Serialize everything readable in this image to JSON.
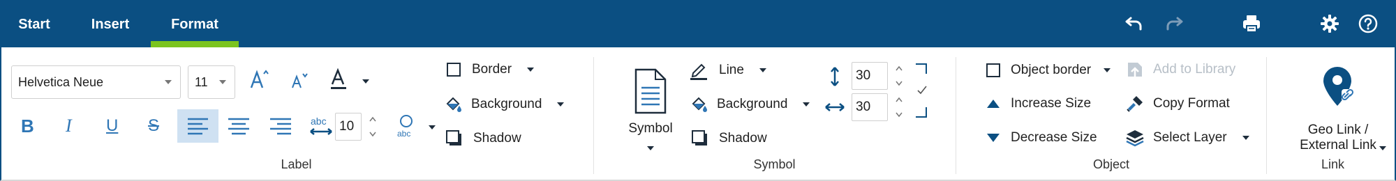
{
  "tabs": [
    {
      "label": "Start"
    },
    {
      "label": "Insert"
    },
    {
      "label": "Format"
    }
  ],
  "active_tab": "Format",
  "colors": {
    "topbar": "#0b4f82",
    "active_underline": "#7bc41f",
    "accent_icon": "#2f76b5",
    "icon_dark": "#0b4f82"
  },
  "toolbar_icons": [
    "undo-icon",
    "redo-icon",
    "print-icon",
    "gear-icon",
    "help-icon"
  ],
  "label_group": {
    "title": "Label",
    "font_family": "Helvetica Neue",
    "font_size": "11",
    "spacing_value": "10",
    "border_label": "Border",
    "background_label": "Background",
    "shadow_label": "Shadow",
    "align_left_active": true
  },
  "symbol_group": {
    "title": "Symbol",
    "symbol_label": "Symbol",
    "line_label": "Line",
    "background_label": "Background",
    "shadow_label": "Shadow",
    "height_value": "30",
    "width_value": "30",
    "lock_ratio_checked": true
  },
  "object_group": {
    "title": "Object",
    "object_border_label": "Object border",
    "increase_label": "Increase Size",
    "decrease_label": "Decrease Size",
    "add_library_label": "Add to Library",
    "copy_format_label": "Copy Format",
    "select_layer_label": "Select Layer"
  },
  "link_group": {
    "title": "Link",
    "geo_link_line1": "Geo Link /",
    "geo_link_line2": "External Link"
  }
}
